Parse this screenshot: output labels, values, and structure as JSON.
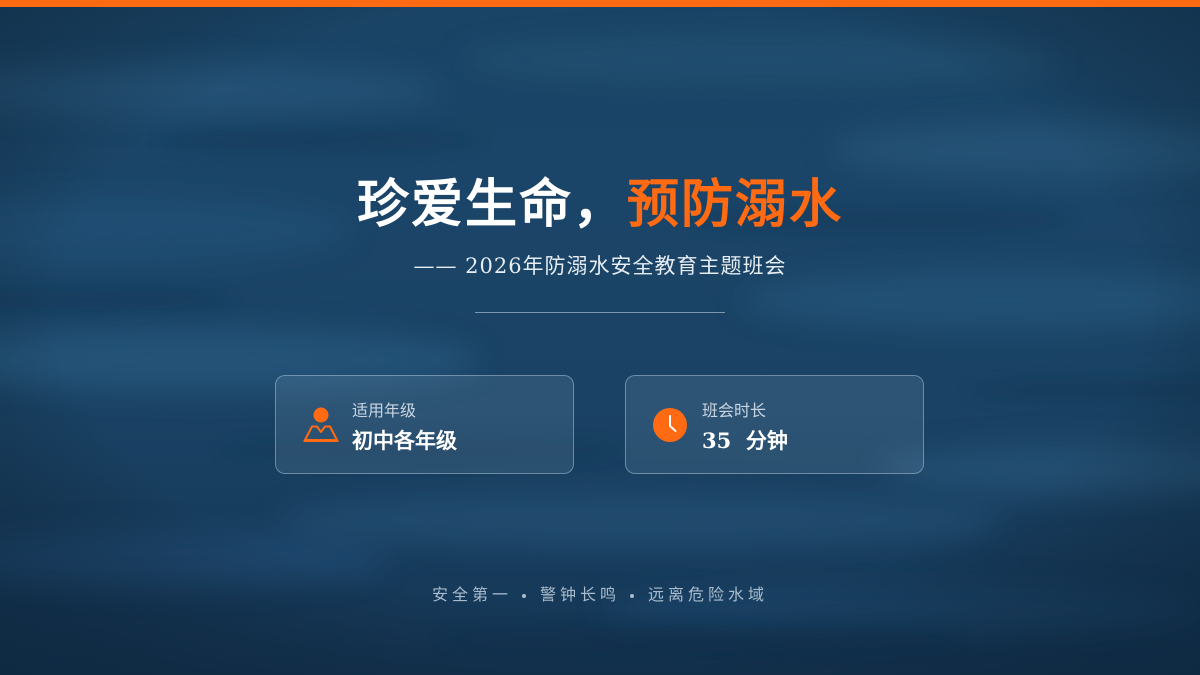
{
  "colors": {
    "accent": "#ff6a13",
    "background": "#1a4466",
    "text": "#ffffff",
    "muted": "#a9bccd"
  },
  "title": {
    "main": "珍爱生命，",
    "accent": "预防溺水"
  },
  "subtitle": "—— 2026年防溺水安全教育主题班会",
  "cards": [
    {
      "icon": "person-icon",
      "label": "适用年级",
      "value": "初中各年级"
    },
    {
      "icon": "clock-icon",
      "label": "班会时长",
      "value": "35  分钟"
    }
  ],
  "footer": {
    "items": [
      "安全第一",
      "警钟长鸣",
      "远离危险水域"
    ]
  }
}
